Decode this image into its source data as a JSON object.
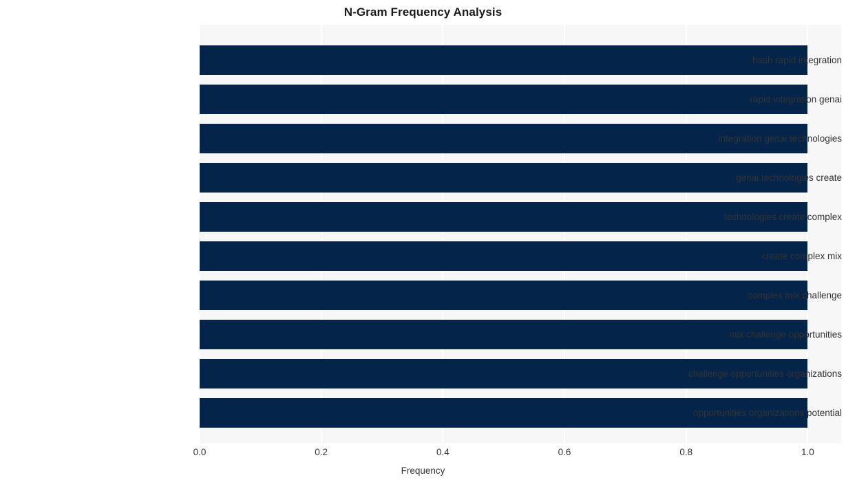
{
  "chart_data": {
    "type": "bar",
    "orientation": "horizontal",
    "title": "N-Gram Frequency Analysis",
    "xlabel": "Frequency",
    "ylabel": "",
    "categories": [
      "hash rapid integration",
      "rapid integration genai",
      "integration genai technologies",
      "genai technologies create",
      "technologies create complex",
      "create complex mix",
      "complex mix challenge",
      "mix challenge opportunities",
      "challenge opportunities organizations",
      "opportunities organizations potential"
    ],
    "values": [
      1.0,
      1.0,
      1.0,
      1.0,
      1.0,
      1.0,
      1.0,
      1.0,
      1.0,
      1.0
    ],
    "xticks": [
      "0.0",
      "0.2",
      "0.4",
      "0.6",
      "0.8",
      "1.0"
    ],
    "xtick_values": [
      0.0,
      0.2,
      0.4,
      0.6,
      0.8,
      1.0
    ],
    "xlim": [
      0.0,
      1.055
    ],
    "grid": true,
    "grid_axis": "x",
    "legend": false,
    "bar_color": "#052449",
    "plot_background": "#f7f7f7",
    "gridline_color": "#ffffff",
    "text_color": "#333333",
    "title_color": "#1a1a1a"
  }
}
